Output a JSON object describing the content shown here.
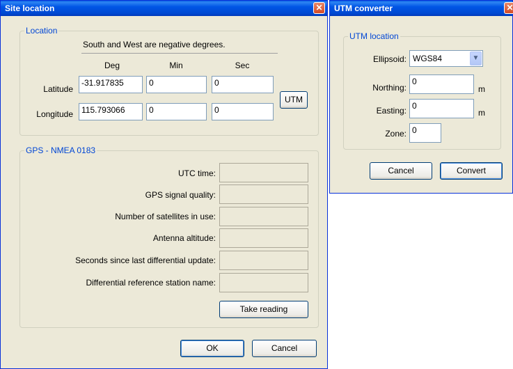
{
  "site_location": {
    "title": "Site location",
    "close_glyph": "✕",
    "location": {
      "legend": "Location",
      "hint": "South and West are negative degrees.",
      "col_deg": "Deg",
      "col_min": "Min",
      "col_sec": "Sec",
      "latitude_label": "Latitude",
      "latitude_deg": "-31.917835",
      "latitude_min": "0",
      "latitude_sec": "0",
      "longitude_label": "Longitude",
      "longitude_deg": "115.793066",
      "longitude_min": "0",
      "longitude_sec": "0",
      "utm_button": "UTM"
    },
    "gps": {
      "legend": "GPS - NMEA 0183",
      "fields": [
        {
          "label": "UTC time:",
          "value": ""
        },
        {
          "label": "GPS signal quality:",
          "value": ""
        },
        {
          "label": "Number of satellites in use:",
          "value": ""
        },
        {
          "label": "Antenna altitude:",
          "value": ""
        },
        {
          "label": "Seconds since last differential update:",
          "value": ""
        },
        {
          "label": "Differential reference station name:",
          "value": ""
        }
      ],
      "take_reading_button": "Take reading"
    },
    "ok_button": "OK",
    "cancel_button": "Cancel"
  },
  "utm_converter": {
    "title": "UTM converter",
    "close_glyph": "✕",
    "group_legend": "UTM location",
    "ellipsoid_label": "Ellipsoid:",
    "ellipsoid_value": "WGS84",
    "northing_label": "Northing:",
    "northing_value": "0",
    "northing_unit": "m",
    "easting_label": "Easting:",
    "easting_value": "0",
    "easting_unit": "m",
    "zone_label": "Zone:",
    "zone_value": "0",
    "cancel_button": "Cancel",
    "convert_button": "Convert"
  }
}
